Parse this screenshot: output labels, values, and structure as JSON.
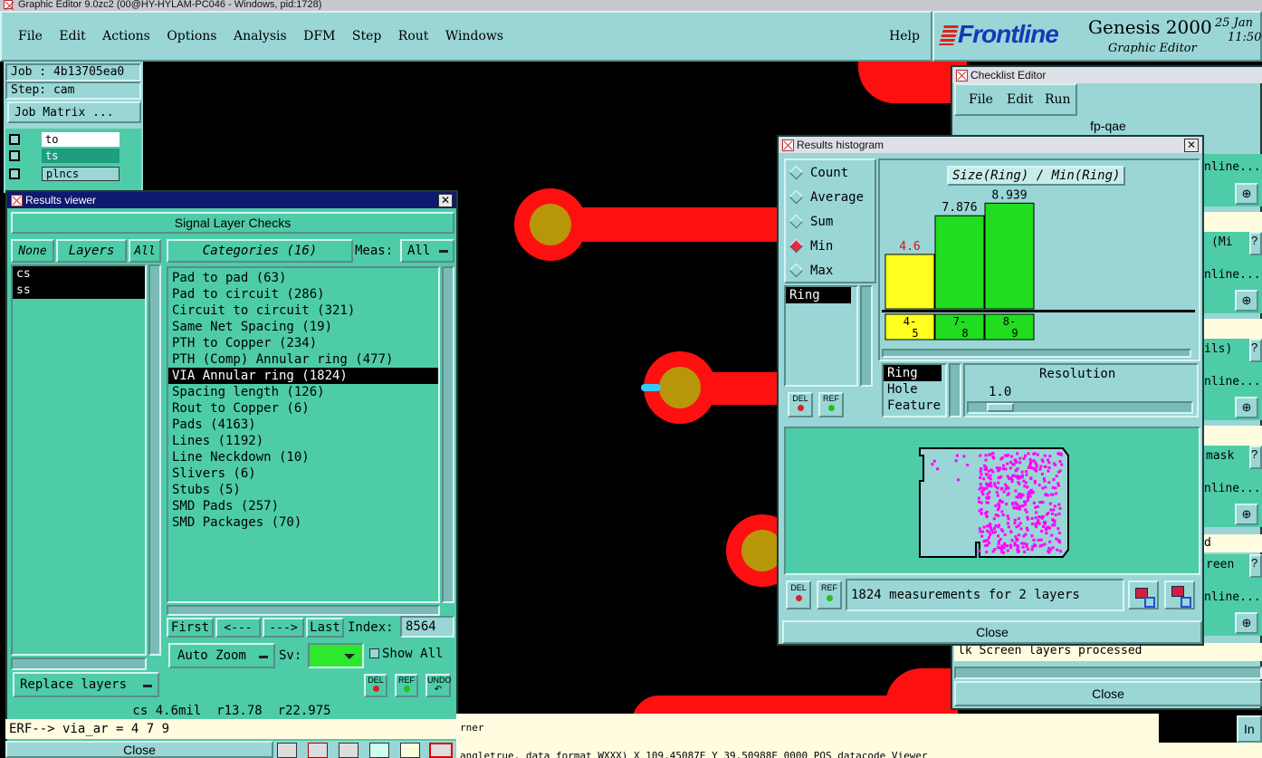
{
  "app": {
    "title": "Graphic Editor 9.0zc2 (00@HY-HYLAM-PC046 - Windows, pid:1728)",
    "menu": [
      "File",
      "Edit",
      "Actions",
      "Options",
      "Analysis",
      "DFM",
      "Step",
      "Rout",
      "Windows"
    ],
    "help": "Help",
    "brand": "Frontline",
    "product": "Genesis 2000",
    "subtitle": "Graphic Editor",
    "date": "25 Jan",
    "time": "11:50"
  },
  "job_panel": {
    "job": "Job : 4b13705ea0",
    "step": "Step: cam",
    "matrix_button": "Job Matrix ...",
    "layers": [
      "to",
      "ts",
      "plncs"
    ]
  },
  "results_viewer": {
    "title": "Results viewer",
    "section": "Signal Layer Checks",
    "none": "None",
    "layers_btn": "Layers",
    "all_btn": "All",
    "categories_btn": "Categories (16)",
    "meas_label": "Meas:",
    "meas_value": "All",
    "layer_list": [
      "cs",
      "ss"
    ],
    "categories": [
      "Pad to pad (63)",
      "Pad to circuit (286)",
      "Circuit to circuit (321)",
      "Same Net Spacing (19)",
      "PTH to Copper (234)",
      "PTH (Comp) Annular ring (477)",
      "VIA Annular ring (1824)",
      "Spacing length (126)",
      "Rout to Copper (6)",
      "Pads (4163)",
      "Lines (1192)",
      "Line Neckdown (10)",
      "Slivers (6)",
      "Stubs (5)",
      "SMD Pads (257)",
      "SMD Packages (70)"
    ],
    "selected_category": 6,
    "nav": {
      "first": "First",
      "prev": "<---",
      "next": "--->",
      "last": "Last",
      "index_label": "Index:",
      "index_value": "8564"
    },
    "auto_zoom": "Auto Zoom",
    "sv_label": "Sv:",
    "show_all": "Show All",
    "replace_layers": "Replace layers",
    "del": "DEL",
    "ref": "REF",
    "undo": "UNDO",
    "status": "cs 4.6mil  r13.78  r22.975",
    "erf": "ERF--> via_ar = 4 7 9",
    "close": "Close"
  },
  "histogram": {
    "title": "Results histogram",
    "modes": [
      "Count",
      "Average",
      "Sum",
      "Min",
      "Max"
    ],
    "selected_mode": "Min",
    "left_list": [
      "Ring"
    ],
    "chart_title": "Size(Ring) / Min(Ring)",
    "del": "DEL",
    "ref": "REF",
    "param_list": [
      "Ring",
      "Hole",
      "Feature"
    ],
    "resolution_label": "Resolution",
    "resolution_value": "1.0",
    "measurements": "1824 measurements for 2 layers",
    "close": "Close"
  },
  "chart_data": {
    "type": "bar",
    "title": "Size(Ring) / Min(Ring)",
    "categories": [
      "4-5",
      "7-8",
      "8-9"
    ],
    "values": [
      4.6,
      7.876,
      8.939
    ],
    "value_labels": [
      "4.6",
      "7.876",
      "8.939"
    ],
    "colors": [
      "#ffff20",
      "#20dd20",
      "#20dd20"
    ],
    "label_colors": [
      "#e01010",
      "#000000",
      "#000000"
    ],
    "ylim": [
      0,
      9.5
    ],
    "grid": false
  },
  "checklist": {
    "title": "Checklist Editor",
    "menu": [
      "File",
      "Edit",
      "Run"
    ],
    "name": "fp-qae",
    "row_labels": [
      "(Mi",
      "ils)",
      "mask",
      "d",
      "reen"
    ],
    "online": "nline...",
    "footer_text": "lk Screen layers processed",
    "close": "Close"
  },
  "bottom": {
    "corner_text": "rner",
    "info_text": "angletrue, data format WXXX) X 109.45087E Y 39.50988E 0000 POS datacode Viewer"
  },
  "colors": {
    "panel": "#9ad6d6",
    "teal": "#4ecca8",
    "copper": "#ff1010",
    "pad": "#b8960a",
    "highlight": "#ff00ff"
  }
}
